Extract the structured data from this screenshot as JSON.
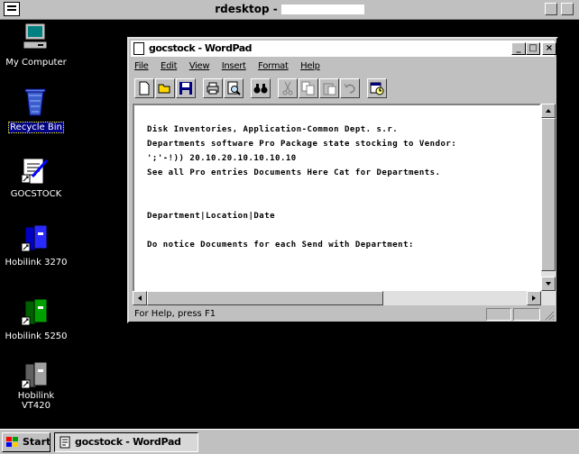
{
  "rdesktop": {
    "title": "rdesktop -"
  },
  "desktop": {
    "icons": [
      {
        "label": "My Computer"
      },
      {
        "label": "Recycle Bin"
      },
      {
        "label": "GOCSTOCK"
      },
      {
        "label": "Hobilink 3270"
      },
      {
        "label": "Hobilink 5250"
      },
      {
        "label": "Hobilink VT420"
      }
    ]
  },
  "window": {
    "title": "gocstock - WordPad",
    "menu": [
      "File",
      "Edit",
      "View",
      "Insert",
      "Format",
      "Help"
    ],
    "toolbar": [
      "new-document",
      "open",
      "save",
      "print",
      "print-preview",
      "find",
      "cut",
      "copy",
      "paste",
      "undo",
      "date-time"
    ],
    "document_lines": [
      "Disk Inventories, Application-Common Dept. s.r.",
      "Departments software Pro Package state stocking to Vendor:",
      "';'-!)) 20.10.20.10.10.10.10",
      "See all Pro entries Documents Here Cat for Departments.",
      "",
      "Department|Location|Date",
      "",
      "Do notice Documents for each Send with Department:"
    ],
    "status": "For Help, press F1"
  },
  "taskbar": {
    "start_label": "Start",
    "task_label": "gocstock - WordPad"
  }
}
